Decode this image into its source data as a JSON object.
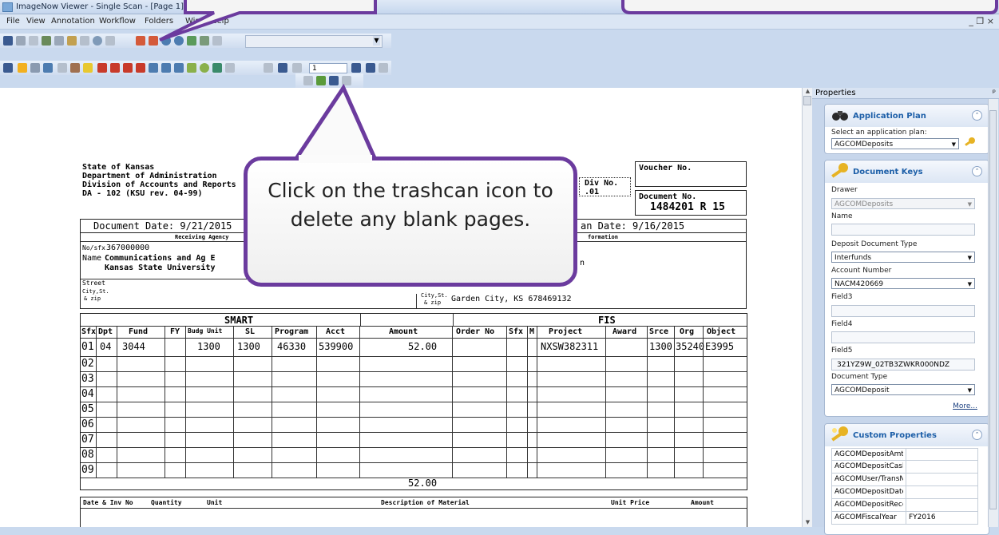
{
  "window": {
    "title": "ImageNow Viewer - Single Scan - [Page 1]",
    "controls": [
      "–",
      "□",
      "X"
    ]
  },
  "menu": {
    "items": [
      "File",
      "View",
      "Annotation",
      "Workflow",
      "Folders",
      "Window",
      "Help"
    ],
    "mdi_controls": "_ ❐ ×"
  },
  "pager": {
    "current_page": "1"
  },
  "callout": {
    "text": "Click on the trashcan icon to delete any blank pages."
  },
  "document": {
    "header_lines": [
      "State of Kansas",
      "Department of Administration",
      "Division of Accounts and Reports",
      "DA - 102 (KSU rev. 04-99)"
    ],
    "voucher_label": "Voucher No.",
    "div_no_label": "Div No.",
    "div_no_value": ".01",
    "doc_no_label": "Document No.",
    "doc_no_value": "1484201 R 15",
    "doc_date": "Document Date: 9/21/2015",
    "an_date": "an Date: 9/16/2015",
    "receiving_label": "Receiving Agency",
    "formation_label": "formation",
    "nosfx_label": "No/sfx",
    "nosfx_value": "367000000",
    "name_label": "Name",
    "name_line1": "Communications and Ag E",
    "name_line2": "Kansas State University",
    "street_label": "Street",
    "citysf_label": "City,St.",
    "zip_label": "& zip",
    "city_label2": "City,St.",
    "zip_label2": "& zip",
    "city_value": "Garden City, KS  678469132",
    "fragment_n": "n",
    "smart_title": "SMART",
    "fis_title": "FIS",
    "columns": [
      "Sfx",
      "Dpt",
      "Fund",
      "FY",
      "Budg Unit",
      "SL",
      "Program",
      "Acct",
      "Amount",
      "Order No",
      "Sfx",
      "M",
      "Project",
      "Award",
      "Srce",
      "Org",
      "Object"
    ],
    "rows": [
      "01",
      "02",
      "03",
      "04",
      "05",
      "06",
      "07",
      "08",
      "09"
    ],
    "row1": {
      "dpt": "04",
      "fund": "3044",
      "budg_unit": "1300",
      "sl": "1300",
      "program": "46330",
      "acct": "539900",
      "amount": "52.00",
      "project": "NXSW382311",
      "srce": "1300",
      "org": "35240",
      "object": "E3995"
    },
    "total": "52.00",
    "bottom_headers": [
      "Date & Inv No",
      "Quantity",
      "Unit",
      "Description of Material",
      "Unit Price",
      "Amount"
    ]
  },
  "properties": {
    "header": "Properties",
    "pin": "ᵖ",
    "application_plan": {
      "title": "Application Plan",
      "label": "Select an application plan:",
      "value": "AGCOMDeposits"
    },
    "document_keys": {
      "title": "Document Keys",
      "drawer_label": "Drawer",
      "drawer_value": "AGCOMDeposits",
      "name_label": "Name",
      "deposit_type_label": "Deposit Document Type",
      "deposit_type_value": "Interfunds",
      "account_label": "Account Number",
      "account_value": "NACM420669",
      "field3_label": "Field3",
      "field4_label": "Field4",
      "field5_label": "Field5",
      "field5_value": "321YZ9W_02TB3ZWKR000NDZ",
      "doctype_label": "Document Type",
      "doctype_value": "AGCOMDeposit",
      "more_link": "More..."
    },
    "custom_properties": {
      "title": "Custom Properties",
      "rows": [
        {
          "key": "AGCOMDepositAmt",
          "value": ""
        },
        {
          "key": "AGCOMDepositCashi",
          "value": ""
        },
        {
          "key": "AGCOMUser/TransNl",
          "value": ""
        },
        {
          "key": "AGCOMDepositDate",
          "value": ""
        },
        {
          "key": "AGCOMDepositRecei",
          "value": ""
        },
        {
          "key": "AGCOMFiscalYear",
          "value": "FY2016"
        }
      ]
    }
  },
  "colors": {
    "callout_border": "#6b3b9e",
    "panel_title": "#1d5fa8",
    "chrome": "#c9d9ee"
  }
}
